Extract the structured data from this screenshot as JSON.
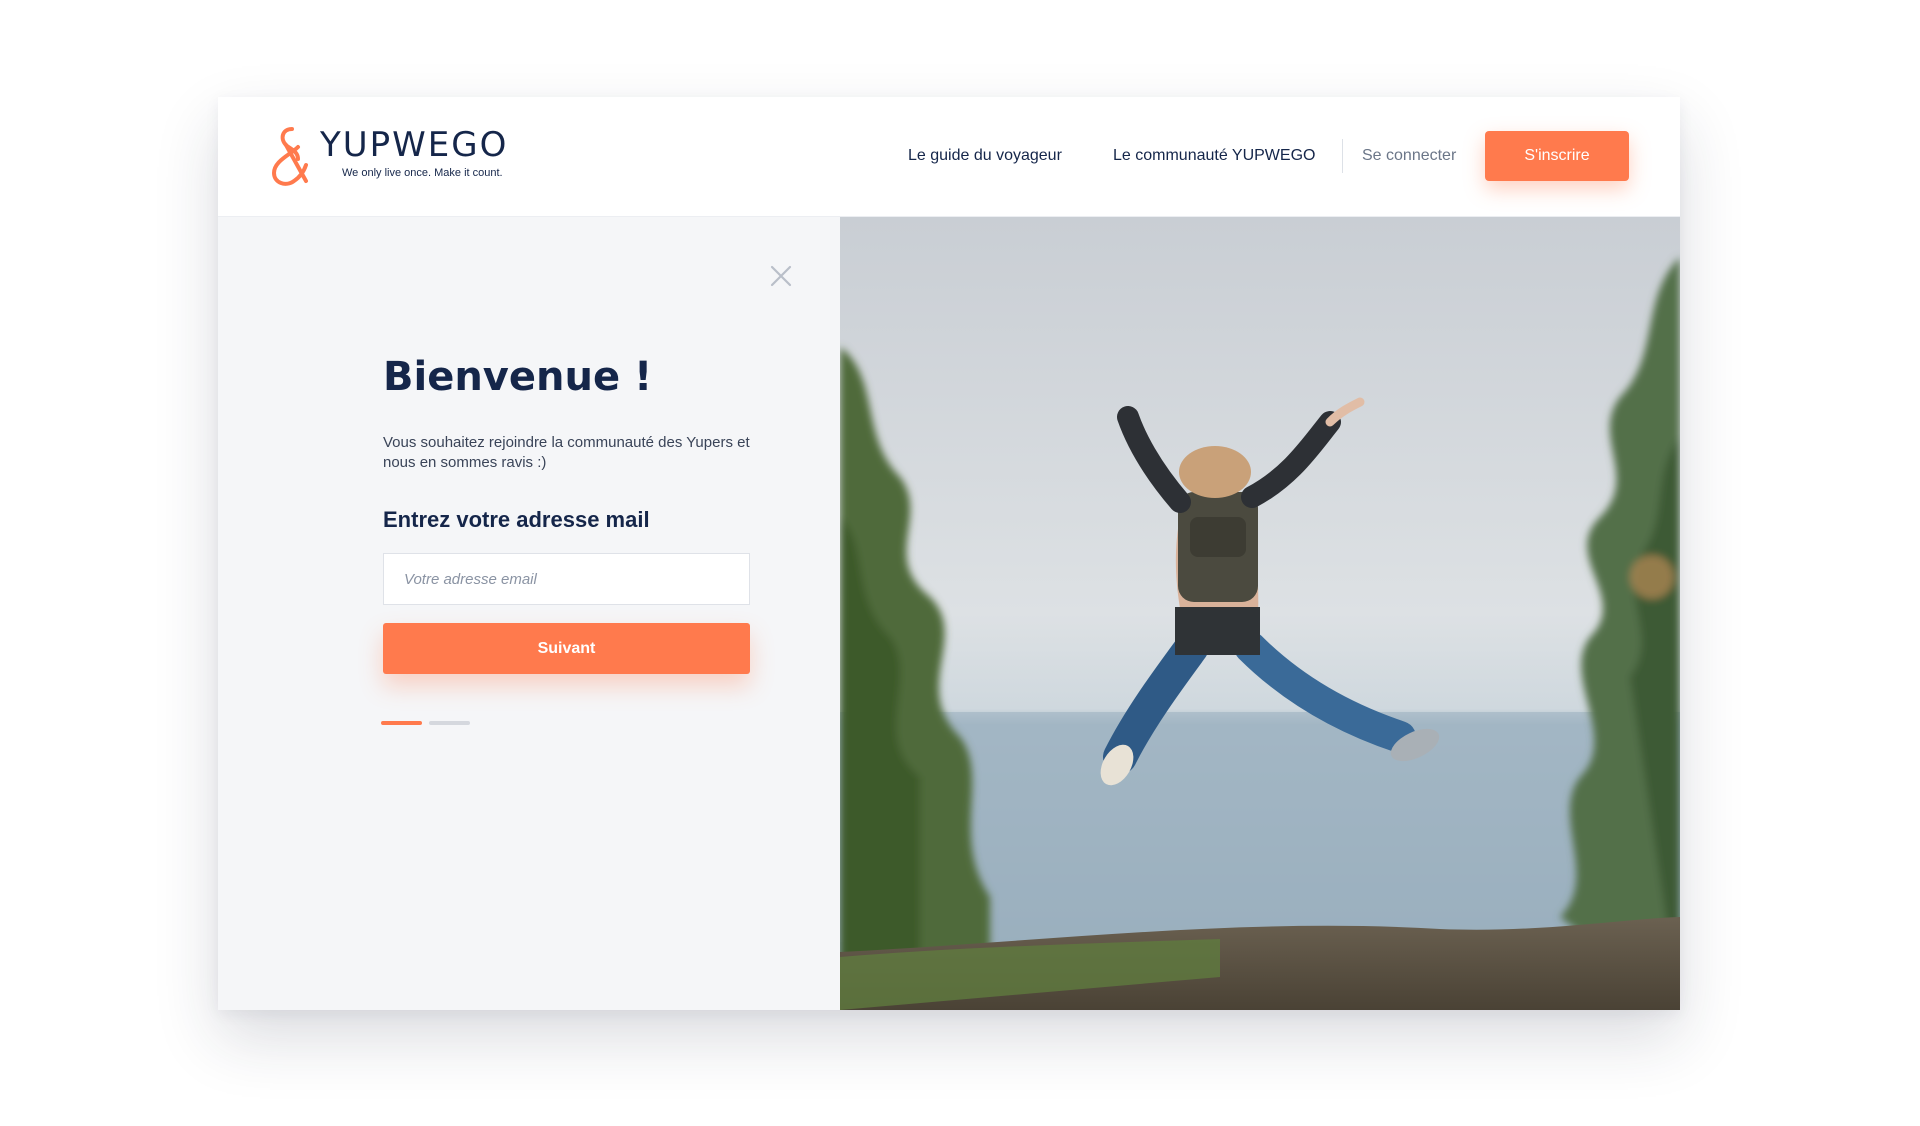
{
  "brand": {
    "name": "YUPWEGO",
    "tagline": "We only live once. Make it count.",
    "accent_color": "#ff7a4d",
    "text_color": "#15264a"
  },
  "nav": {
    "guide": "Le guide du voyageur",
    "community": "Le communauté YUPWEGO",
    "login": "Se connecter",
    "signup": "S'inscrire"
  },
  "panel": {
    "close_icon": "close-icon",
    "title": "Bienvenue !",
    "subtitle": "Vous souhaitez rejoindre la communauté des Yupers et nous en sommes ravis :)",
    "email_label": "Entrez votre adresse mail",
    "email_placeholder": "Votre adresse email",
    "email_value": "",
    "next_button": "Suivant",
    "steps_total": 2,
    "current_step": 1
  },
  "hero_image": {
    "description_icon": "photo-person-jumping"
  }
}
